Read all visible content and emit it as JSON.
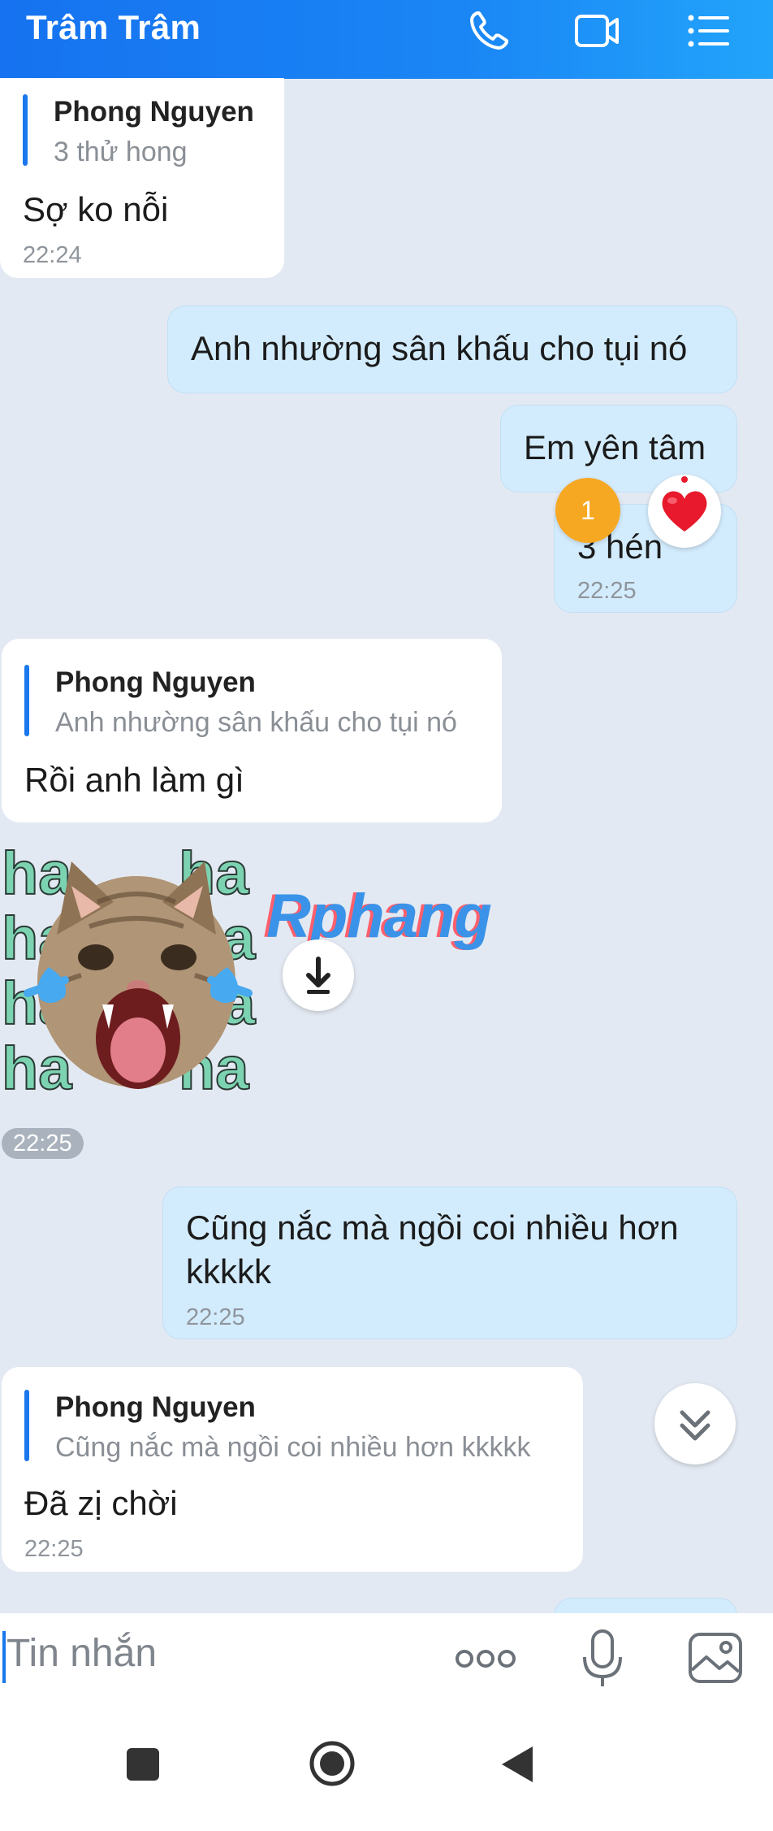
{
  "header": {
    "title": "Trâm Trâm"
  },
  "messages": {
    "m1": {
      "quote_author": "Phong Nguyen",
      "quote_text": "3 thử hong",
      "text": "Sợ ko nỗi",
      "time": "22:24"
    },
    "m2": {
      "text": "Anh nhường sân khấu cho tụi nó"
    },
    "m3": {
      "text": "Em yên tâm"
    },
    "m4": {
      "text": "3 hén",
      "time": "22:25",
      "reaction_count": "1"
    },
    "m5": {
      "quote_author": "Phong Nguyen",
      "quote_text": "Anh nhường sân khấu cho tụi nó",
      "text": "Rồi anh làm gì"
    },
    "sticker": {
      "watermark": "Rphang",
      "time": "22:25"
    },
    "m6": {
      "text_line1": "Cũng nắc mà ngồi coi nhiều hơn",
      "text_line2": "kkkkk",
      "time": "22:25"
    },
    "m7": {
      "quote_author": "Phong Nguyen",
      "quote_text": "Cũng nắc mà ngồi coi nhiều hơn kkkkk",
      "text": "Đã zị chời",
      "time": "22:25"
    }
  },
  "input": {
    "placeholder": "Tin nhắn"
  },
  "colors": {
    "brand": "#1a77ec",
    "sent_bubble": "#d3ecfd",
    "background": "#e3e9f2",
    "reaction": "#e8192c",
    "badge": "#f7a823"
  },
  "icons": [
    "phone-icon",
    "video-call-icon",
    "menu-list-icon",
    "heart-icon",
    "download-icon",
    "scroll-down-icon",
    "more-icon",
    "microphone-icon",
    "image-icon",
    "recent-apps-icon",
    "home-icon",
    "back-icon"
  ]
}
